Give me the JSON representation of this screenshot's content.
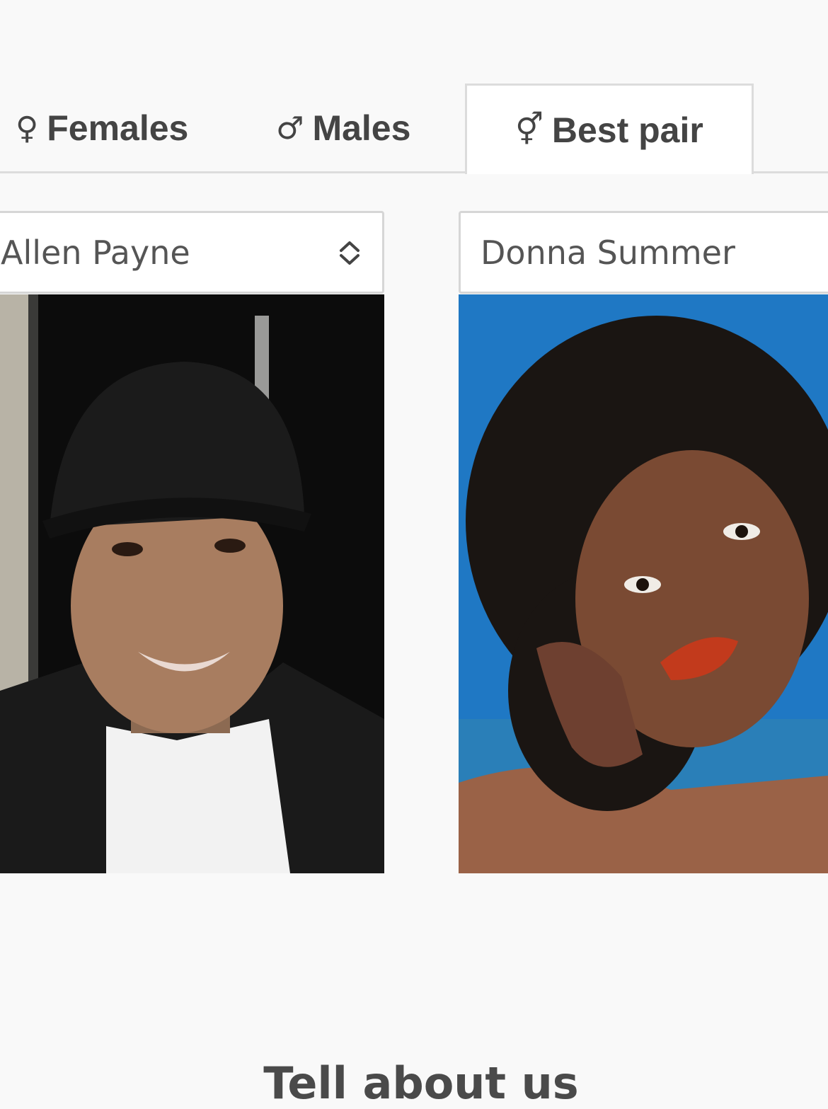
{
  "tabs": [
    {
      "symbol": "♀",
      "label": "Females"
    },
    {
      "symbol": "♂",
      "label": "Males"
    },
    {
      "symbol": "⚥",
      "label": "Best pair"
    }
  ],
  "selectors": {
    "left": {
      "value": "Allen Payne"
    },
    "right": {
      "value": "Donna Summer"
    }
  },
  "footer": {
    "title": "Tell about us"
  },
  "colors": {
    "tab_border": "#dcdcdc",
    "text": "#444444",
    "right_photo_bg": "#1f78c4"
  }
}
